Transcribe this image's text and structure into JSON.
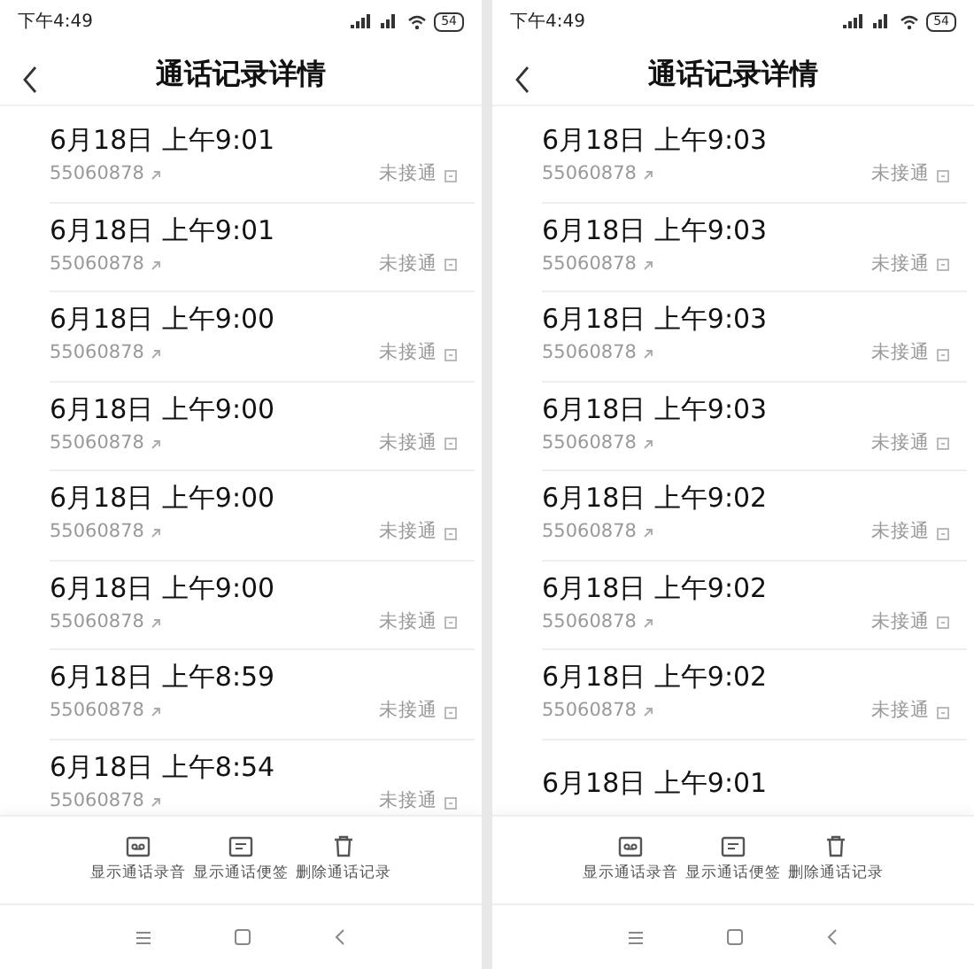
{
  "screens": [
    {
      "status_bar": {
        "time": "下午4:49",
        "battery": "54"
      },
      "title": "通话记录详情",
      "calls": [
        {
          "time": "6月18日 上午9:01",
          "number": "55060878",
          "status": "未接通"
        },
        {
          "time": "6月18日 上午9:01",
          "number": "55060878",
          "status": "未接通"
        },
        {
          "time": "6月18日 上午9:00",
          "number": "55060878",
          "status": "未接通"
        },
        {
          "time": "6月18日 上午9:00",
          "number": "55060878",
          "status": "未接通"
        },
        {
          "time": "6月18日 上午9:00",
          "number": "55060878",
          "status": "未接通"
        },
        {
          "time": "6月18日 上午9:00",
          "number": "55060878",
          "status": "未接通"
        },
        {
          "time": "6月18日 上午8:59",
          "number": "55060878",
          "status": "未接通"
        },
        {
          "time": "6月18日 上午8:54",
          "number": "55060878",
          "status": "未接通"
        }
      ],
      "actions": [
        "显示通话录音",
        "显示通话便签",
        "删除通话记录"
      ]
    },
    {
      "status_bar": {
        "time": "下午4:49",
        "battery": "54"
      },
      "title": "通话记录详情",
      "calls": [
        {
          "time": "6月18日 上午9:03",
          "number": "55060878",
          "status": "未接通"
        },
        {
          "time": "6月18日 上午9:03",
          "number": "55060878",
          "status": "未接通"
        },
        {
          "time": "6月18日 上午9:03",
          "number": "55060878",
          "status": "未接通"
        },
        {
          "time": "6月18日 上午9:03",
          "number": "55060878",
          "status": "未接通"
        },
        {
          "time": "6月18日 上午9:02",
          "number": "55060878",
          "status": "未接通"
        },
        {
          "time": "6月18日 上午9:02",
          "number": "55060878",
          "status": "未接通"
        },
        {
          "time": "6月18日 上午9:02",
          "number": "55060878",
          "status": "未接通"
        },
        {
          "time": "6月18日 上午9:01"
        }
      ],
      "actions": [
        "显示通话录音",
        "显示通话便签",
        "删除通话记录"
      ]
    }
  ]
}
